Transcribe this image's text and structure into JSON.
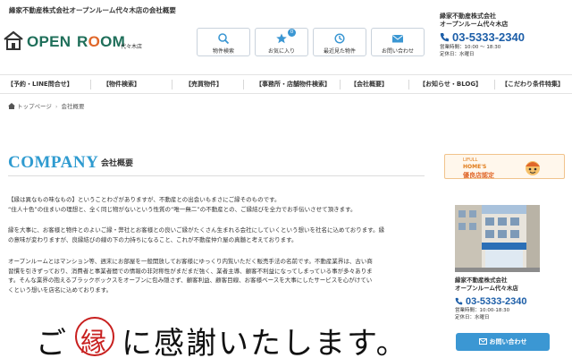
{
  "header": {
    "tagline": "縁家不動産株式会社オープンルーム代々木店の会社概要",
    "logo": {
      "brand_open": "OPEN",
      "brand_room_r": "R",
      "brand_room_o": "O",
      "brand_room_rest": "OM",
      "branch": "代々木店"
    },
    "buttons": [
      {
        "label": "物件検索",
        "icon": "search-icon"
      },
      {
        "label": "お気に入り",
        "icon": "star-icon",
        "badge": "0"
      },
      {
        "label": "最近見た物件",
        "icon": "history-icon"
      },
      {
        "label": "お問い合わせ",
        "icon": "mail-icon"
      }
    ],
    "info": {
      "company_line1": "縁家不動産株式会社",
      "company_line2": "オープンルーム代々木店",
      "tel": "03-5333-2340",
      "hours": "営業時間：10:00 ～ 18:30",
      "closed": "定休日：水曜日"
    }
  },
  "nav": {
    "items": [
      "【予約・LINE問合せ】",
      "【物件検索】",
      "【売買物件】",
      "【事務所・店舗物件検索】",
      "【会社概要】",
      "【お知らせ・BLOG】",
      "【こだわり条件特集】"
    ]
  },
  "breadcrumb": {
    "home": "トップページ",
    "current": "会社概要"
  },
  "page": {
    "title_en": "COMPANY",
    "title_jp": "会社概要",
    "paragraphs": [
      "【縁は異なもの味なもの】ということわざがありますが、不動産との出会いもまさにご縁そのものです。\n“住人十色”の住まいの理想と、全く同じ物がないという性質の“唯一無二”の不動産との、ご縁結びを全力でお手伝いさせて頂きます。",
      "縁を大事に、お客様と物件とのよいご縁・弊社とお客様との良いご縁がたくさん生まれる会社にしていくという想いを社名に込めております。縁\nの意味が変わりますが、良縁結びの線の下の力持ちになること、これが不動産仲介屋の真髄と考えております。",
      "オープンルームとはマンション等、週末にお部屋を一般開放してお客様にゆっくり内覧いただく販売手法の名前です。不動産業界は、古い商\n習慣を引きずっており、消費者と事業者間での情報の非対称性がまだまだ強く、業者主導、顧客不利益になってしまっている事が多々ありま\nす。そんな業界の抱えるブラックボックスをオープンに包み隠さず、顧客利益、顧客目線、お客様ベースを大事にしたサービスを心がけてい\nくという想いを店名に込めております。"
    ],
    "calligraphy": {
      "pre": "ご",
      "en": "縁",
      "post": "に感謝いたします。"
    }
  },
  "sidebar": {
    "homes_badge": {
      "line1": "LIFULL",
      "line2": "HOME'S",
      "line3": "優良店認定"
    },
    "company_line1": "縁家不動産株式会社",
    "company_line2": "オープンルーム代々木店",
    "tel": "03-5333-2340",
    "hours": "営業時間：10:00-18:30",
    "closed": "定休日：水曜日",
    "contact_button": "お問い合わせ"
  },
  "colors": {
    "accent_blue": "#3b97d3",
    "tel_blue": "#1c5ea8",
    "brand_green": "#1f6f5a",
    "brand_orange": "#e0672a",
    "seal_red": "#c8201f"
  }
}
